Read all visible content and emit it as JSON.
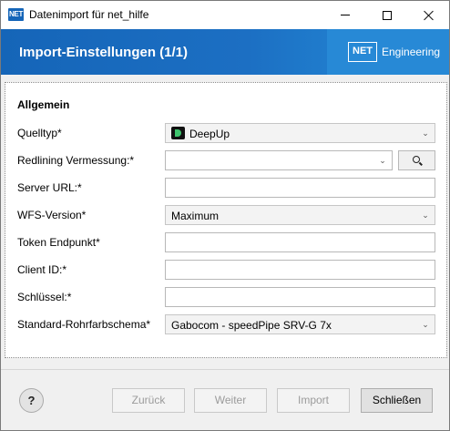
{
  "window": {
    "app_icon_text": "NET",
    "title": "Datenimport für net_hilfe"
  },
  "header": {
    "title": "Import-Einstellungen (1/1)",
    "brand_box": "NET",
    "brand_text": "Engineering"
  },
  "form": {
    "section_title": "Allgemein",
    "fields": {
      "source_type": {
        "label": "Quelltyp*",
        "value": "DeepUp",
        "icon": "deepup-logo-icon"
      },
      "redlining": {
        "label": "Redlining Vermessung:*",
        "value": ""
      },
      "server_url": {
        "label": "Server URL:*",
        "value": ""
      },
      "wfs_version": {
        "label": "WFS-Version*",
        "value": "Maximum"
      },
      "token_endpoint": {
        "label": "Token Endpunkt*",
        "value": ""
      },
      "client_id": {
        "label": "Client ID:*",
        "value": ""
      },
      "key": {
        "label": "Schlüssel:*",
        "value": ""
      },
      "pipe_color_scheme": {
        "label": "Standard-Rohrfarbschema*",
        "value": "Gabocom - speedPipe SRV-G 7x"
      }
    }
  },
  "footer": {
    "help_label": "?",
    "back_label": "Zurück",
    "next_label": "Weiter",
    "import_label": "Import",
    "close_label": "Schließen"
  },
  "colors": {
    "banner": "#1565b8",
    "brand_panel": "#2789d6",
    "deepup_green": "#3ec46d"
  }
}
